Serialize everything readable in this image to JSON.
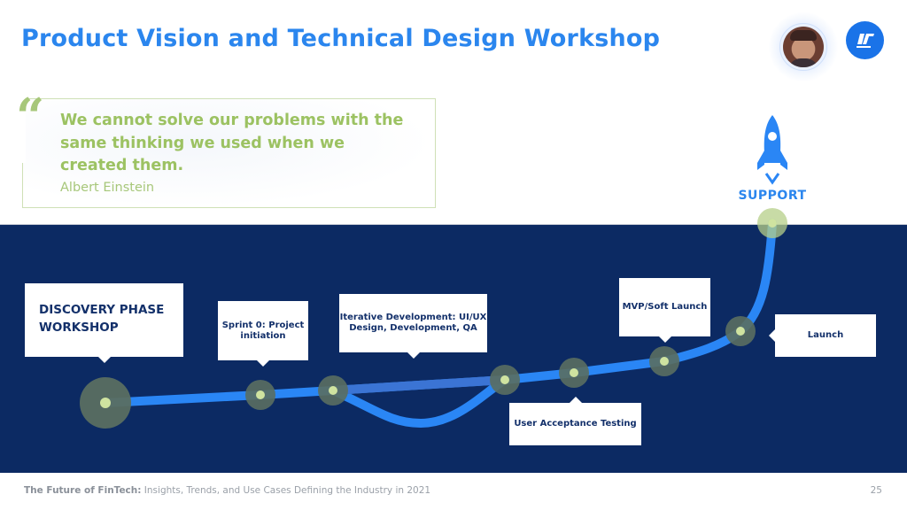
{
  "header": {
    "title": "Product Vision and Technical Design Workshop",
    "avatar": "presenter-photo",
    "logo_icon": "company-logo-icon"
  },
  "quote": {
    "mark": "“",
    "text": "We cannot solve our problems with the same thinking we used when we created them.",
    "author": "Albert Einstein"
  },
  "roadmap": {
    "top_label": "SUPPORT",
    "top_icon": "rocket-icon",
    "steps": [
      {
        "label": "DISCOVERY PHASE WORKSHOP"
      },
      {
        "label": "Sprint 0: Project initiation"
      },
      {
        "label": "Iterative Development: UI/UX Design, Development, QA"
      },
      {
        "label": "User Acceptance Testing"
      },
      {
        "label": "MVP/Soft Launch"
      },
      {
        "label": "Launch"
      }
    ]
  },
  "colors": {
    "title": "#2b86ee",
    "band": "#0c2a63",
    "path": "#2a86f5",
    "quote": "#9cc262",
    "node_halo": "#5a6e61",
    "node_dot": "#cfe3a0"
  },
  "footer": {
    "brand": "The Future of FinTech:",
    "subtitle": " Insights, Trends, and Use Cases Defining the Industry in 2021",
    "page_number": "25"
  }
}
